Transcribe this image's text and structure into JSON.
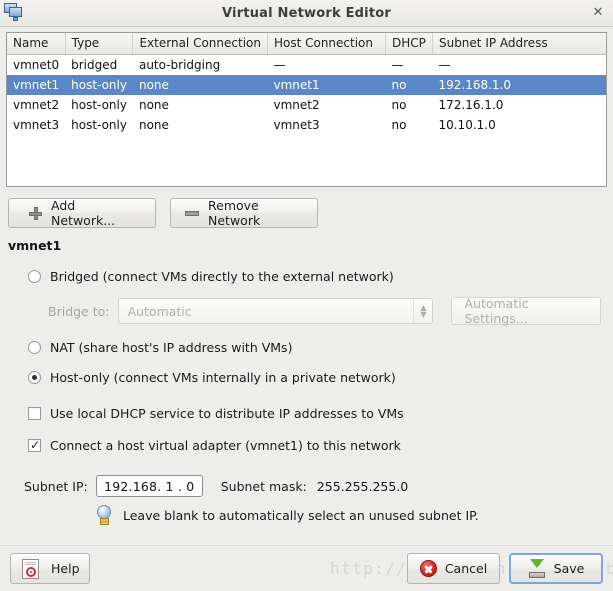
{
  "window": {
    "title": "Virtual Network Editor",
    "icon": "network-icon",
    "close_label": "✕"
  },
  "table": {
    "headers": [
      "Name",
      "Type",
      "External Connection",
      "Host Connection",
      "DHCP",
      "Subnet IP Address"
    ],
    "rows": [
      {
        "name": "vmnet0",
        "type": "bridged",
        "external": "auto-bridging",
        "host": "—",
        "dhcp": "—",
        "subnet": "—",
        "selected": false
      },
      {
        "name": "vmnet1",
        "type": "host-only",
        "external": "none",
        "host": "vmnet1",
        "dhcp": "no",
        "subnet": "192.168.1.0",
        "selected": true
      },
      {
        "name": "vmnet2",
        "type": "host-only",
        "external": "none",
        "host": "vmnet2",
        "dhcp": "no",
        "subnet": "172.16.1.0",
        "selected": false
      },
      {
        "name": "vmnet3",
        "type": "host-only",
        "external": "none",
        "host": "vmnet3",
        "dhcp": "no",
        "subnet": "10.10.1.0",
        "selected": false
      }
    ],
    "selected_row_color": "#5b87c7"
  },
  "network_buttons": {
    "add_label": "Add Network...",
    "remove_label": "Remove Network"
  },
  "details": {
    "section_title": "vmnet1",
    "bridged_label": "Bridged (connect VMs directly to the external network)",
    "bridged_selected": false,
    "bridge_to_label": "Bridge to:",
    "bridge_to_value": "Automatic",
    "automatic_settings_label": "Automatic Settings...",
    "nat_label": "NAT (share host's IP address with VMs)",
    "nat_selected": false,
    "hostonly_label": "Host-only (connect VMs internally in a private network)",
    "hostonly_selected": true,
    "dhcp_checkbox_label": "Use local DHCP service to distribute IP addresses to VMs",
    "dhcp_checked": false,
    "adapter_checkbox_label": "Connect a host virtual adapter (vmnet1) to this network",
    "adapter_checked": true
  },
  "subnet": {
    "ip_label": "Subnet IP:",
    "ip_value": "192.168. 1 . 0",
    "mask_label": "Subnet mask:",
    "mask_value": "255.255.255.0",
    "hint": "Leave blank to automatically select an unused subnet IP.",
    "hint_icon": "lightbulb-icon"
  },
  "footer": {
    "help_label": "Help",
    "cancel_label": "Cancel",
    "save_label": "Save"
  },
  "watermark": {
    "text": "http://blog.csdn.net/usvdb"
  }
}
